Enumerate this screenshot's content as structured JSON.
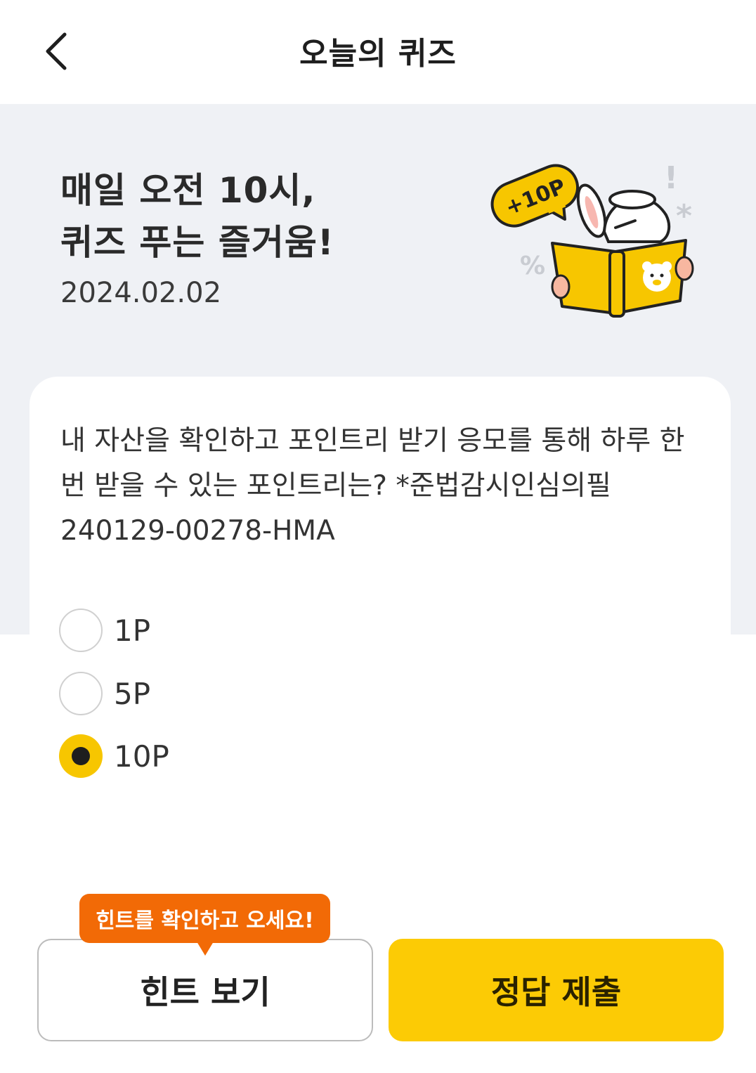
{
  "header": {
    "title": "오늘의 퀴즈"
  },
  "hero": {
    "title_line1": "매일 오전 10시,",
    "title_line2": "퀴즈 푸는 즐거움!",
    "date": "2024.02.02",
    "badge_text": "+10P"
  },
  "quiz": {
    "question_lines": [
      "내 자산을 확인하고 포인트리 받기 응모를 통해 하루 한",
      "번 받을 수 있는 포인트리는? *준법감시인심의필",
      "240129-00278-HMA"
    ],
    "options": [
      {
        "label": "1P",
        "selected": false
      },
      {
        "label": "5P",
        "selected": false
      },
      {
        "label": "10P",
        "selected": true
      }
    ]
  },
  "actions": {
    "hint_tooltip": "힌트를 확인하고 오세요!",
    "hint_button": "힌트 보기",
    "submit_button": "정답 제출"
  },
  "colors": {
    "hero_background": "#eff1f5",
    "accent_yellow": "#fccb05",
    "tooltip_orange": "#f26a06"
  }
}
